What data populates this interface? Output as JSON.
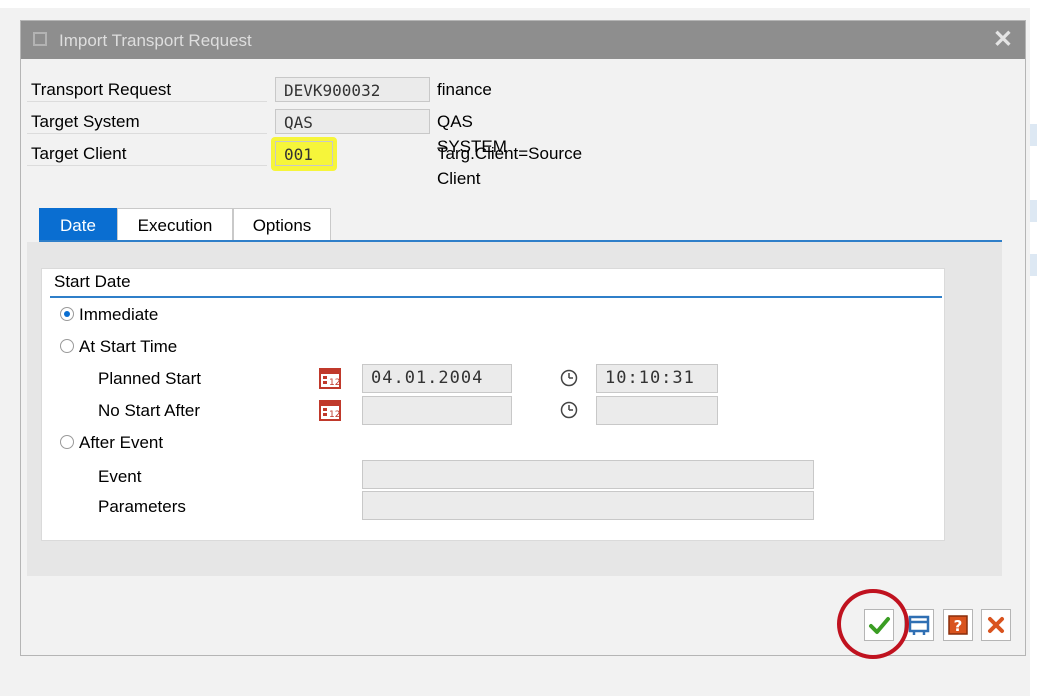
{
  "dialog": {
    "title": "Import Transport Request"
  },
  "header": {
    "rows": [
      {
        "label": "Transport Request",
        "value": "DEVK900032",
        "description": "finance"
      },
      {
        "label": "Target System",
        "value": "QAS",
        "description": "QAS SYSTEM"
      },
      {
        "label": "Target Client",
        "value": "001",
        "description": "Targ.Client=Source Client"
      }
    ]
  },
  "tabs": [
    {
      "label": "Date",
      "active": true
    },
    {
      "label": "Execution",
      "active": false
    },
    {
      "label": "Options",
      "active": false
    }
  ],
  "start_date": {
    "group_title": "Start Date",
    "options": [
      {
        "label": "Immediate",
        "selected": true
      },
      {
        "label": "At Start Time",
        "selected": false
      },
      {
        "label": "After Event",
        "selected": false
      }
    ],
    "planned_start_label": "Planned Start",
    "planned_start_date": "04.01.2004",
    "planned_start_time": "10:10:31",
    "no_start_after_label": "No Start After",
    "no_start_after_date": "",
    "no_start_after_time": "",
    "event_label": "Event",
    "event_value": "",
    "parameters_label": "Parameters",
    "parameters_value": ""
  },
  "buttons": [
    {
      "name": "continue",
      "icon": "green-checkmark-icon"
    },
    {
      "name": "schedule",
      "icon": "schedule-icon"
    },
    {
      "name": "help",
      "icon": "help-icon"
    },
    {
      "name": "cancel",
      "icon": "cancel-x-icon"
    }
  ],
  "colors": {
    "accent": "#0a6ed1",
    "highlight": "#f6f53a",
    "annotation_circle": "#c0121f",
    "titlebar": "#8e8e8e"
  }
}
